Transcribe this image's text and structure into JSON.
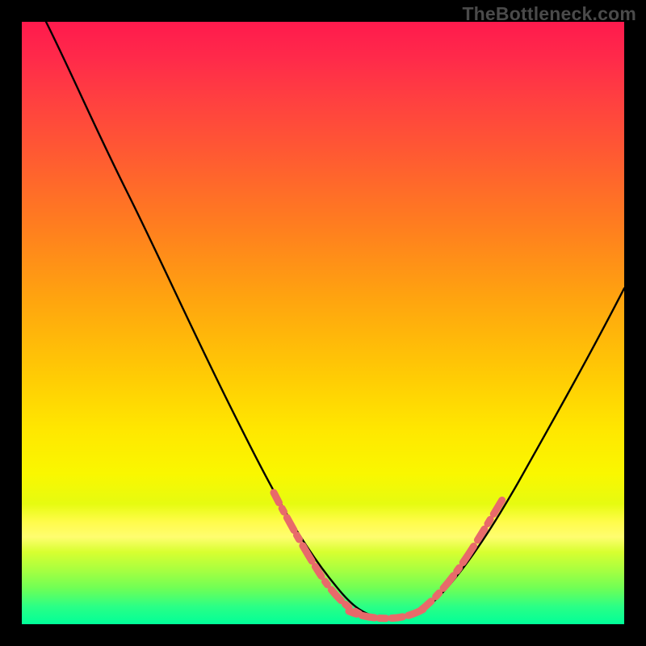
{
  "attribution": "TheBottleneck.com",
  "chart_data": {
    "type": "line",
    "title": "",
    "xlabel": "",
    "ylabel": "",
    "xlim": [
      0,
      100
    ],
    "ylim": [
      0,
      100
    ],
    "series": [
      {
        "name": "bottleneck-curve",
        "x": [
          4,
          8,
          12,
          16,
          20,
          24,
          28,
          32,
          36,
          40,
          44,
          48,
          52,
          56,
          58,
          60,
          64,
          68,
          72,
          76,
          80,
          84,
          88,
          92,
          96,
          100
        ],
        "values": [
          100,
          92,
          84,
          76,
          68,
          60,
          52,
          44,
          36,
          29,
          22,
          16,
          10,
          5,
          3,
          2,
          2,
          4,
          8,
          14,
          21,
          28,
          35,
          42,
          49,
          56
        ],
        "color": "#000000"
      }
    ],
    "highlight_segments": [
      {
        "description": "left-descending-highlight",
        "color": "#e86a6a",
        "x_range": [
          42,
          56
        ],
        "y_range": [
          20,
          3
        ]
      },
      {
        "description": "valley-floor-highlight",
        "color": "#e86a6a",
        "x_range": [
          54,
          68
        ],
        "y_range": [
          3,
          3
        ]
      },
      {
        "description": "right-ascending-highlight",
        "color": "#e86a6a",
        "x_range": [
          66,
          78
        ],
        "y_range": [
          3,
          18
        ]
      }
    ],
    "gradient_stops": [
      {
        "pos": 0,
        "color": "#ff1a4d"
      },
      {
        "pos": 50,
        "color": "#ffc400"
      },
      {
        "pos": 85,
        "color": "#faff40"
      },
      {
        "pos": 100,
        "color": "#00ff99"
      }
    ]
  }
}
